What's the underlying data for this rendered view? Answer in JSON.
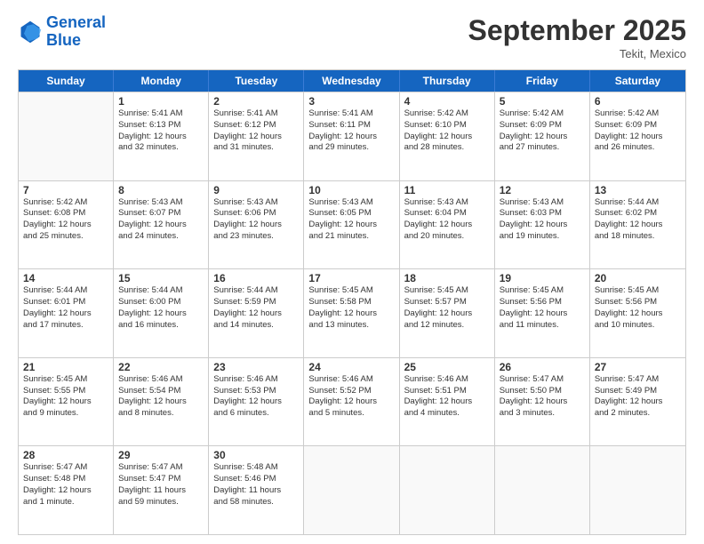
{
  "logo": {
    "line1": "General",
    "line2": "Blue"
  },
  "title": "September 2025",
  "subtitle": "Tekit, Mexico",
  "days_of_week": [
    "Sunday",
    "Monday",
    "Tuesday",
    "Wednesday",
    "Thursday",
    "Friday",
    "Saturday"
  ],
  "weeks": [
    [
      {
        "day": null,
        "text": ""
      },
      {
        "day": "1",
        "text": "Sunrise: 5:41 AM\nSunset: 6:13 PM\nDaylight: 12 hours\nand 32 minutes."
      },
      {
        "day": "2",
        "text": "Sunrise: 5:41 AM\nSunset: 6:12 PM\nDaylight: 12 hours\nand 31 minutes."
      },
      {
        "day": "3",
        "text": "Sunrise: 5:41 AM\nSunset: 6:11 PM\nDaylight: 12 hours\nand 29 minutes."
      },
      {
        "day": "4",
        "text": "Sunrise: 5:42 AM\nSunset: 6:10 PM\nDaylight: 12 hours\nand 28 minutes."
      },
      {
        "day": "5",
        "text": "Sunrise: 5:42 AM\nSunset: 6:09 PM\nDaylight: 12 hours\nand 27 minutes."
      },
      {
        "day": "6",
        "text": "Sunrise: 5:42 AM\nSunset: 6:09 PM\nDaylight: 12 hours\nand 26 minutes."
      }
    ],
    [
      {
        "day": "7",
        "text": "Sunrise: 5:42 AM\nSunset: 6:08 PM\nDaylight: 12 hours\nand 25 minutes."
      },
      {
        "day": "8",
        "text": "Sunrise: 5:43 AM\nSunset: 6:07 PM\nDaylight: 12 hours\nand 24 minutes."
      },
      {
        "day": "9",
        "text": "Sunrise: 5:43 AM\nSunset: 6:06 PM\nDaylight: 12 hours\nand 23 minutes."
      },
      {
        "day": "10",
        "text": "Sunrise: 5:43 AM\nSunset: 6:05 PM\nDaylight: 12 hours\nand 21 minutes."
      },
      {
        "day": "11",
        "text": "Sunrise: 5:43 AM\nSunset: 6:04 PM\nDaylight: 12 hours\nand 20 minutes."
      },
      {
        "day": "12",
        "text": "Sunrise: 5:43 AM\nSunset: 6:03 PM\nDaylight: 12 hours\nand 19 minutes."
      },
      {
        "day": "13",
        "text": "Sunrise: 5:44 AM\nSunset: 6:02 PM\nDaylight: 12 hours\nand 18 minutes."
      }
    ],
    [
      {
        "day": "14",
        "text": "Sunrise: 5:44 AM\nSunset: 6:01 PM\nDaylight: 12 hours\nand 17 minutes."
      },
      {
        "day": "15",
        "text": "Sunrise: 5:44 AM\nSunset: 6:00 PM\nDaylight: 12 hours\nand 16 minutes."
      },
      {
        "day": "16",
        "text": "Sunrise: 5:44 AM\nSunset: 5:59 PM\nDaylight: 12 hours\nand 14 minutes."
      },
      {
        "day": "17",
        "text": "Sunrise: 5:45 AM\nSunset: 5:58 PM\nDaylight: 12 hours\nand 13 minutes."
      },
      {
        "day": "18",
        "text": "Sunrise: 5:45 AM\nSunset: 5:57 PM\nDaylight: 12 hours\nand 12 minutes."
      },
      {
        "day": "19",
        "text": "Sunrise: 5:45 AM\nSunset: 5:56 PM\nDaylight: 12 hours\nand 11 minutes."
      },
      {
        "day": "20",
        "text": "Sunrise: 5:45 AM\nSunset: 5:56 PM\nDaylight: 12 hours\nand 10 minutes."
      }
    ],
    [
      {
        "day": "21",
        "text": "Sunrise: 5:45 AM\nSunset: 5:55 PM\nDaylight: 12 hours\nand 9 minutes."
      },
      {
        "day": "22",
        "text": "Sunrise: 5:46 AM\nSunset: 5:54 PM\nDaylight: 12 hours\nand 8 minutes."
      },
      {
        "day": "23",
        "text": "Sunrise: 5:46 AM\nSunset: 5:53 PM\nDaylight: 12 hours\nand 6 minutes."
      },
      {
        "day": "24",
        "text": "Sunrise: 5:46 AM\nSunset: 5:52 PM\nDaylight: 12 hours\nand 5 minutes."
      },
      {
        "day": "25",
        "text": "Sunrise: 5:46 AM\nSunset: 5:51 PM\nDaylight: 12 hours\nand 4 minutes."
      },
      {
        "day": "26",
        "text": "Sunrise: 5:47 AM\nSunset: 5:50 PM\nDaylight: 12 hours\nand 3 minutes."
      },
      {
        "day": "27",
        "text": "Sunrise: 5:47 AM\nSunset: 5:49 PM\nDaylight: 12 hours\nand 2 minutes."
      }
    ],
    [
      {
        "day": "28",
        "text": "Sunrise: 5:47 AM\nSunset: 5:48 PM\nDaylight: 12 hours\nand 1 minute."
      },
      {
        "day": "29",
        "text": "Sunrise: 5:47 AM\nSunset: 5:47 PM\nDaylight: 11 hours\nand 59 minutes."
      },
      {
        "day": "30",
        "text": "Sunrise: 5:48 AM\nSunset: 5:46 PM\nDaylight: 11 hours\nand 58 minutes."
      },
      {
        "day": null,
        "text": ""
      },
      {
        "day": null,
        "text": ""
      },
      {
        "day": null,
        "text": ""
      },
      {
        "day": null,
        "text": ""
      }
    ]
  ]
}
